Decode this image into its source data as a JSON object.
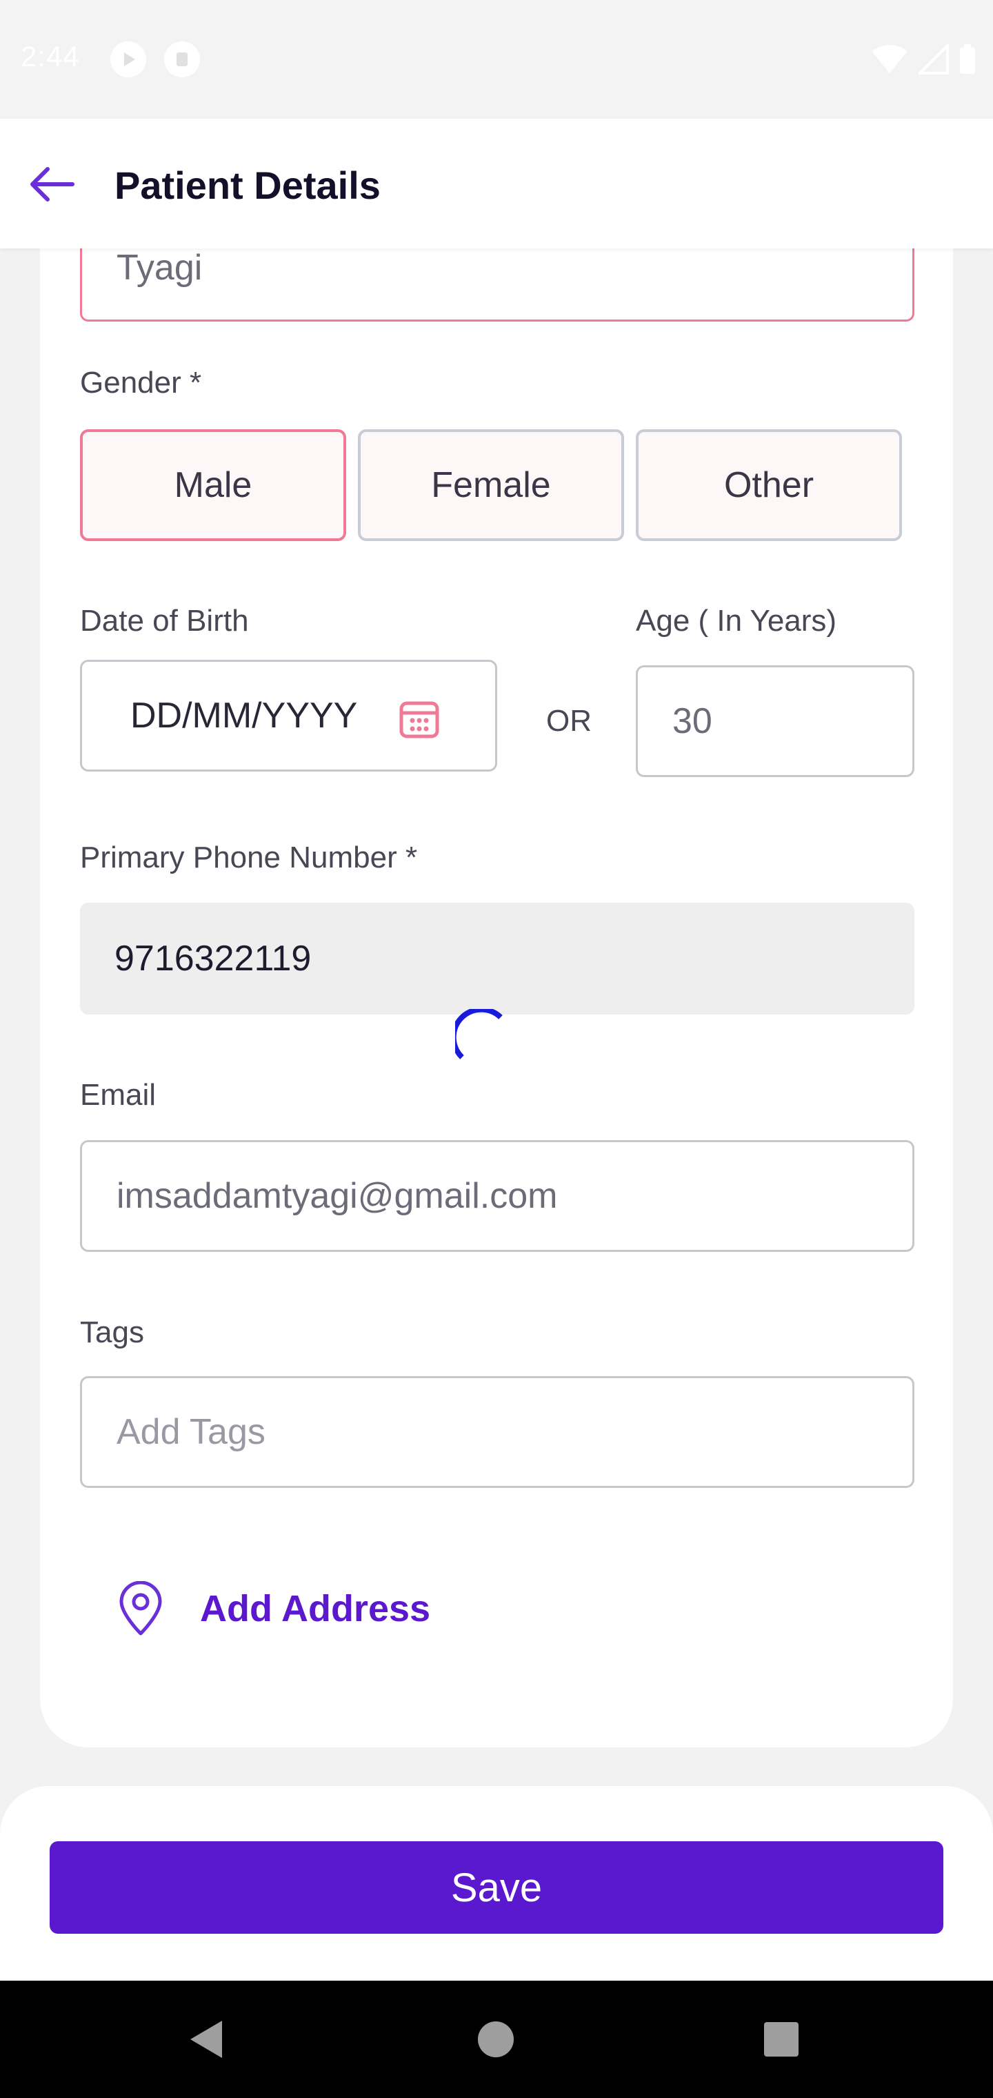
{
  "status_bar": {
    "time": "2:44"
  },
  "header": {
    "title": "Patient Details",
    "back_icon": "arrow-left-icon"
  },
  "form": {
    "last_name_value": "Tyagi",
    "gender_label": "Gender *",
    "gender_options": [
      "Male",
      "Female",
      "Other"
    ],
    "gender_selected": "Male",
    "dob_label": "Date of Birth",
    "dob_placeholder": "DD/MM/YYYY",
    "or_text": "OR",
    "age_label": "Age ( In Years)",
    "age_value": "30",
    "phone_label": "Primary Phone Number *",
    "phone_value": "9716322119",
    "email_label": "Email",
    "email_value": "imsaddamtyagi@gmail.com",
    "tags_label": "Tags",
    "tags_placeholder": "Add Tags",
    "add_address_label": "Add Address"
  },
  "footer": {
    "save_label": "Save"
  },
  "colors": {
    "primary": "#5a18cf",
    "selected_border": "#f07a95",
    "disabled_field": "#eeeeee",
    "spinner": "#1a1adb"
  }
}
